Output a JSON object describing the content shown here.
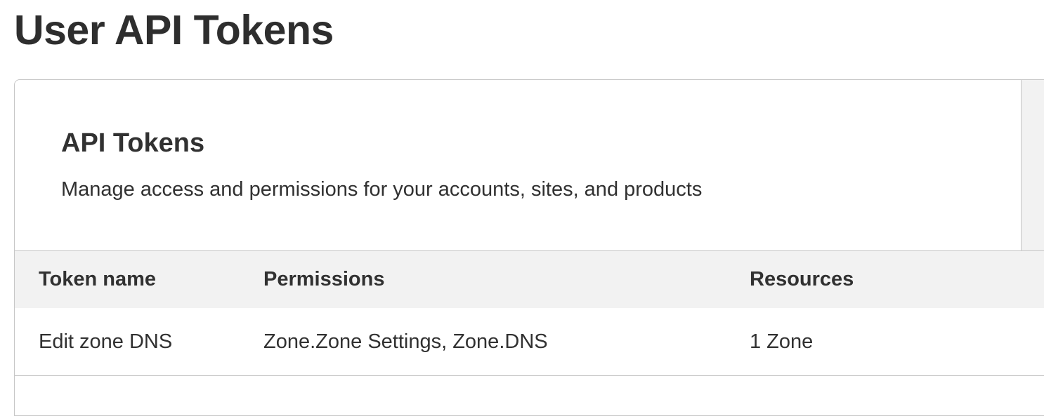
{
  "page": {
    "title": "User API Tokens"
  },
  "card": {
    "title": "API Tokens",
    "description": "Manage access and permissions for your accounts, sites, and products"
  },
  "table": {
    "columns": [
      "Token name",
      "Permissions",
      "Resources"
    ],
    "rows": [
      {
        "token_name": "Edit zone DNS",
        "permissions": "Zone.Zone Settings, Zone.DNS",
        "resources": "1 Zone"
      }
    ]
  }
}
